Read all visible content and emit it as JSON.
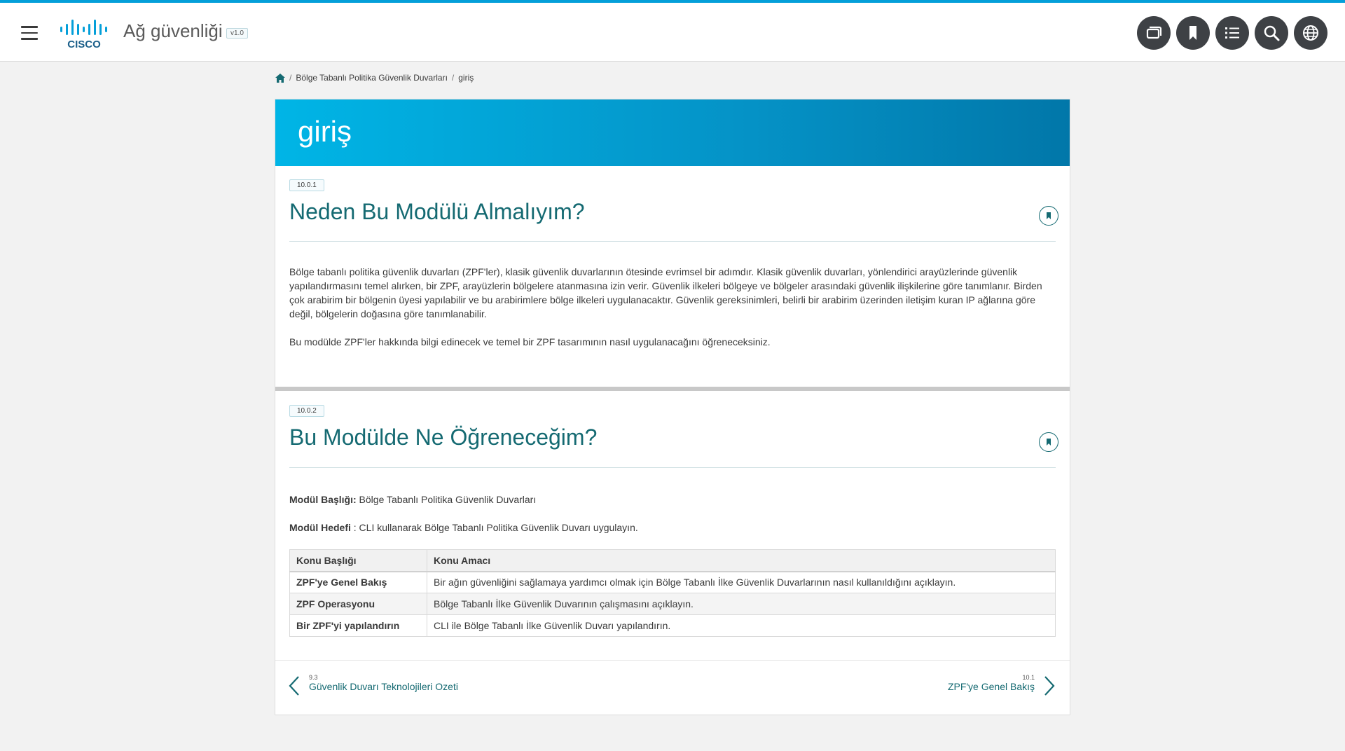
{
  "header": {
    "app_title": "Ağ güvenliği",
    "version": "v1.0",
    "logo_text": "CISCO",
    "buttons": [
      {
        "name": "windows-icon"
      },
      {
        "name": "bookmark-icon"
      },
      {
        "name": "list-icon"
      },
      {
        "name": "search-icon"
      },
      {
        "name": "globe-icon"
      }
    ]
  },
  "breadcrumb": {
    "items": [
      "Bölge Tabanlı Politika Güvenlik Duvarları",
      "giriş"
    ]
  },
  "banner": {
    "title": "giriş"
  },
  "section1": {
    "tag": "10.0.1",
    "title": "Neden Bu Modülü Almalıyım?",
    "para1": "Bölge tabanlı politika güvenlik duvarları (ZPF'ler), klasik güvenlik duvarlarının ötesinde evrimsel bir adımdır. Klasik güvenlik duvarları, yönlendirici arayüzlerinde güvenlik yapılandırmasını temel alırken, bir ZPF, arayüzlerin bölgelere atanmasına izin verir. Güvenlik ilkeleri bölgeye ve bölgeler arasındaki güvenlik ilişkilerine göre tanımlanır. Birden çok arabirim bir bölgenin üyesi yapılabilir ve bu arabirimlere bölge ilkeleri uygulanacaktır. Güvenlik gereksinimleri, belirli bir arabirim üzerinden iletişim kuran IP ağlarına göre değil, bölgelerin doğasına göre tanımlanabilir.",
    "para2": "Bu modülde ZPF'ler hakkında bilgi edinecek ve temel bir ZPF tasarımının nasıl uygulanacağını öğreneceksiniz."
  },
  "section2": {
    "tag": "10.0.2",
    "title": "Bu Modülde Ne Öğreneceğim?",
    "module_title_label": "Modül Başlığı:",
    "module_title_value": " Bölge Tabanlı Politika Güvenlik Duvarları",
    "module_goal_label": "Modül Hedefi",
    "module_goal_value": " : CLI kullanarak Bölge Tabanlı Politika Güvenlik Duvarı uygulayın.",
    "table": {
      "headers": [
        "Konu Başlığı",
        "Konu Amacı"
      ],
      "rows": [
        [
          "ZPF'ye Genel Bakış",
          "Bir ağın güvenliğini sağlamaya yardımcı olmak için Bölge Tabanlı İlke Güvenlik Duvarlarının nasıl kullanıldığını açıklayın."
        ],
        [
          "ZPF Operasyonu",
          "Bölge Tabanlı İlke Güvenlik Duvarının çalışmasını açıklayın."
        ],
        [
          "Bir ZPF'yi yapılandırın",
          "CLI ile Bölge Tabanlı İlke Güvenlik Duvarı yapılandırın."
        ]
      ]
    }
  },
  "nav": {
    "prev": {
      "num": "9.3",
      "label": "Güvenlik Duvarı Teknolojileri Ozeti"
    },
    "next": {
      "num": "10.1",
      "label": "ZPF'ye Genel Bakış"
    }
  }
}
